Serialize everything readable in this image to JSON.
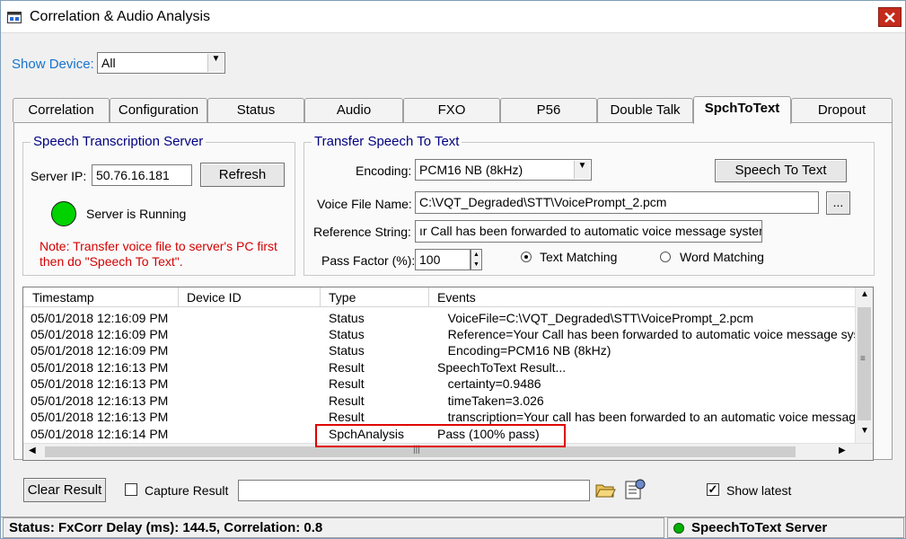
{
  "window": {
    "title": "Correlation & Audio Analysis",
    "close": "✕"
  },
  "device": {
    "label": "Show Device:",
    "value": "All"
  },
  "tabs": [
    "Correlation",
    "Configuration",
    "Status",
    "Audio",
    "FXO",
    "P56",
    "Double Talk",
    "SpchToText",
    "Dropout"
  ],
  "active_tab": "SpchToText",
  "server": {
    "group_title": "Speech Transcription Server",
    "ip_label": "Server IP:",
    "ip_value": "50.76.16.181",
    "refresh": "Refresh",
    "status_text": "Server is Running",
    "status_color": "#00c800",
    "note": "Note: Transfer voice file to server's PC first then do \"Speech To Text\"."
  },
  "transfer": {
    "group_title": "Transfer Speech To Text",
    "encoding_label": "Encoding:",
    "encoding_value": "PCM16 NB (8kHz)",
    "speech_button": "Speech To Text",
    "voice_label": "Voice File Name:",
    "voice_value": "C:\\VQT_Degraded\\STT\\VoicePrompt_2.pcm",
    "browse": "...",
    "ref_label": "Reference String:",
    "ref_value": "ır Call has been forwarded to automatic voice message system",
    "pass_label": "Pass Factor (%):",
    "pass_value": "100",
    "text_matching": "Text Matching",
    "word_matching": "Word Matching"
  },
  "log": {
    "columns": [
      "Timestamp",
      "Device ID",
      "Type",
      "Events"
    ],
    "rows": [
      [
        "05/01/2018 12:16:09 PM",
        "",
        "Status",
        "   VoiceFile=C:\\VQT_Degraded\\STT\\VoicePrompt_2.pcm"
      ],
      [
        "05/01/2018 12:16:09 PM",
        "",
        "Status",
        "   Reference=Your Call has been forwarded to automatic voice message sys"
      ],
      [
        "05/01/2018 12:16:09 PM",
        "",
        "Status",
        "   Encoding=PCM16 NB (8kHz)"
      ],
      [
        "05/01/2018 12:16:13 PM",
        "",
        "Result",
        "SpeechToText Result..."
      ],
      [
        "05/01/2018 12:16:13 PM",
        "",
        "Result",
        "   certainty=0.9486"
      ],
      [
        "05/01/2018 12:16:13 PM",
        "",
        "Result",
        "   timeTaken=3.026"
      ],
      [
        "05/01/2018 12:16:13 PM",
        "",
        "Result",
        "   transcription=Your call has been forwarded to an automatic voice messag"
      ],
      [
        "05/01/2018 12:16:14 PM",
        "",
        "SpchAnalysis",
        "Pass (100% pass)"
      ]
    ]
  },
  "bottom": {
    "clear": "Clear Result",
    "capture": "Capture Result",
    "show_latest": "Show latest"
  },
  "statusbar": {
    "left": "Status: FxCorr Delay (ms): 144.5, Correlation: 0.8",
    "right": "SpeechToText Server",
    "right_color": "#00b000"
  }
}
